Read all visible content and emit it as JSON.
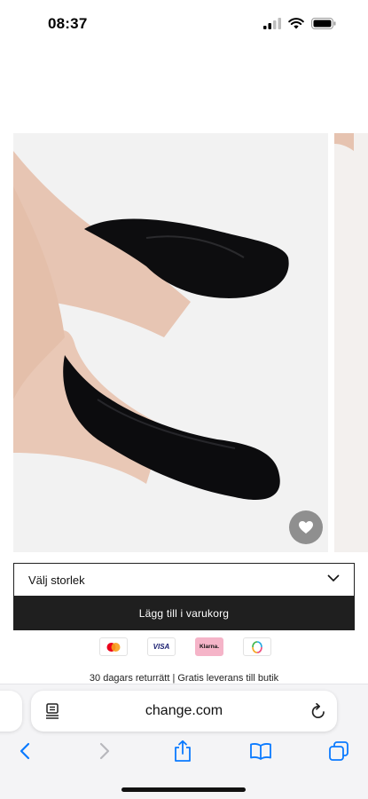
{
  "status_bar": {
    "time": "08:37"
  },
  "product": {
    "image_description_icon": "photo",
    "favorite_icon": "heart-icon"
  },
  "size_select": {
    "label": "Välj storlek"
  },
  "cart": {
    "add_label": "Lägg till i varukorg"
  },
  "payments": {
    "visa": "VISA",
    "klarna": "Klarna."
  },
  "info": {
    "returns_text": "30 dagars returrätt | Gratis leverans till butik"
  },
  "browser": {
    "url": "change.com"
  },
  "colors": {
    "cart_button_bg": "#1f1f1f",
    "favorite_button_bg": "#8f8f8f",
    "browser_bar_bg": "#f4f4f6",
    "ios_blue": "#0a7aff"
  }
}
